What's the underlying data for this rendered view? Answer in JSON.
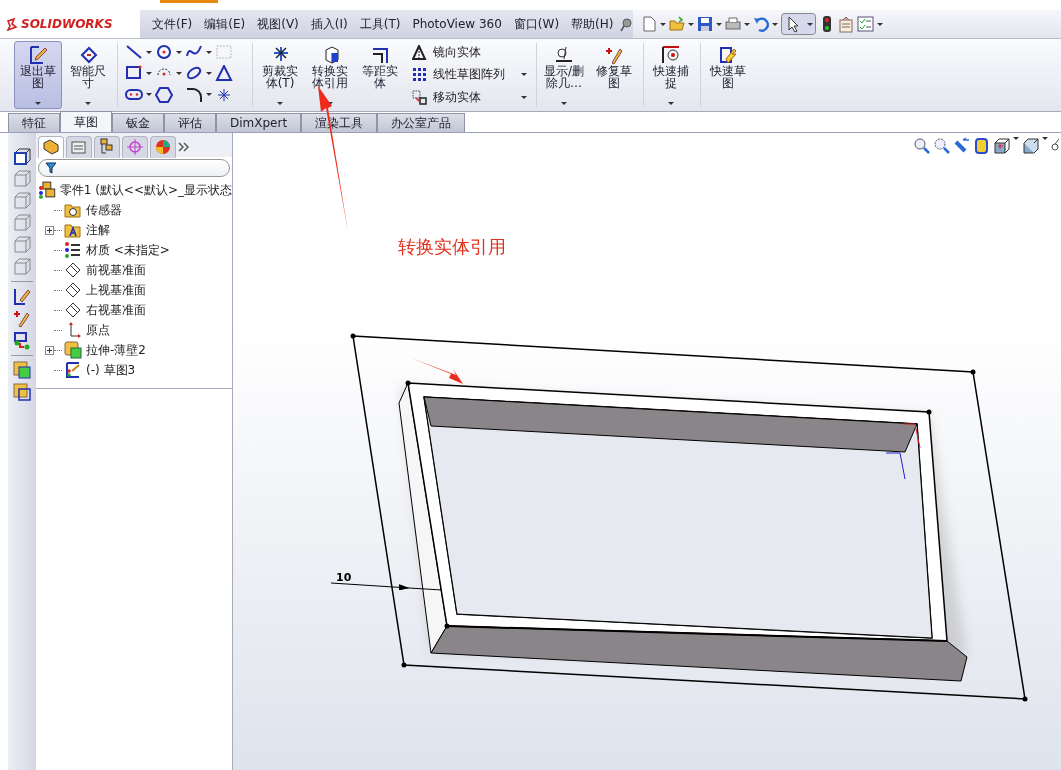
{
  "app": {
    "logo_text": "SOLIDWORKS"
  },
  "menu": [
    "文件(F)",
    "编辑(E)",
    "视图(V)",
    "插入(I)",
    "工具(T)",
    "PhotoView 360",
    "窗口(W)",
    "帮助(H)"
  ],
  "ribbon": [
    {
      "kind": "large",
      "label": "退出草图",
      "selected": true
    },
    {
      "kind": "large",
      "label": "智能尺寸",
      "selected": false
    },
    {
      "kind": "grid"
    },
    {
      "kind": "large",
      "label": "剪裁实体(T)",
      "selected": false
    },
    {
      "kind": "large",
      "label": "转换实体引用",
      "selected": false
    },
    {
      "kind": "large",
      "label": "等距实体",
      "selected": false
    },
    {
      "kind": "list",
      "items": [
        "镜向实体",
        "线性草图阵列",
        "移动实体"
      ]
    },
    {
      "kind": "large",
      "label": "显示/删除几…",
      "selected": false
    },
    {
      "kind": "large",
      "label": "修复草图",
      "selected": false
    },
    {
      "kind": "large",
      "label": "快速捕捉",
      "selected": false
    },
    {
      "kind": "large",
      "label": "快速草图",
      "selected": false
    }
  ],
  "tabs": [
    {
      "label": "特征",
      "selected": false
    },
    {
      "label": "草图",
      "selected": true
    },
    {
      "label": "钣金",
      "selected": false
    },
    {
      "label": "评估",
      "selected": false
    },
    {
      "label": "DimXpert",
      "selected": false
    },
    {
      "label": "渲染工具",
      "selected": false
    },
    {
      "label": "办公室产品",
      "selected": false
    }
  ],
  "feature_tree": {
    "panel_tabs": [
      {
        "selected": true
      },
      {
        "selected": false
      },
      {
        "selected": false
      },
      {
        "selected": false
      },
      {
        "selected": false
      }
    ],
    "root": {
      "label": "零件1  (默认<<默认>_显示状态",
      "children": [
        {
          "label": "传感器",
          "collapsed": false
        },
        {
          "label": "注解",
          "collapsed": true
        },
        {
          "label": "材质 <未指定>",
          "collapsed": false
        },
        {
          "label": "前视基准面",
          "collapsed": false
        },
        {
          "label": "上视基准面",
          "collapsed": false
        },
        {
          "label": "右视基准面",
          "collapsed": false
        },
        {
          "label": "原点",
          "collapsed": false
        },
        {
          "label": "拉伸-薄壁2",
          "collapsed": true
        },
        {
          "label": "(-) 草图3",
          "collapsed": false
        }
      ]
    }
  },
  "graphics": {
    "dimension": "10",
    "annotation": "转换实体引用"
  }
}
